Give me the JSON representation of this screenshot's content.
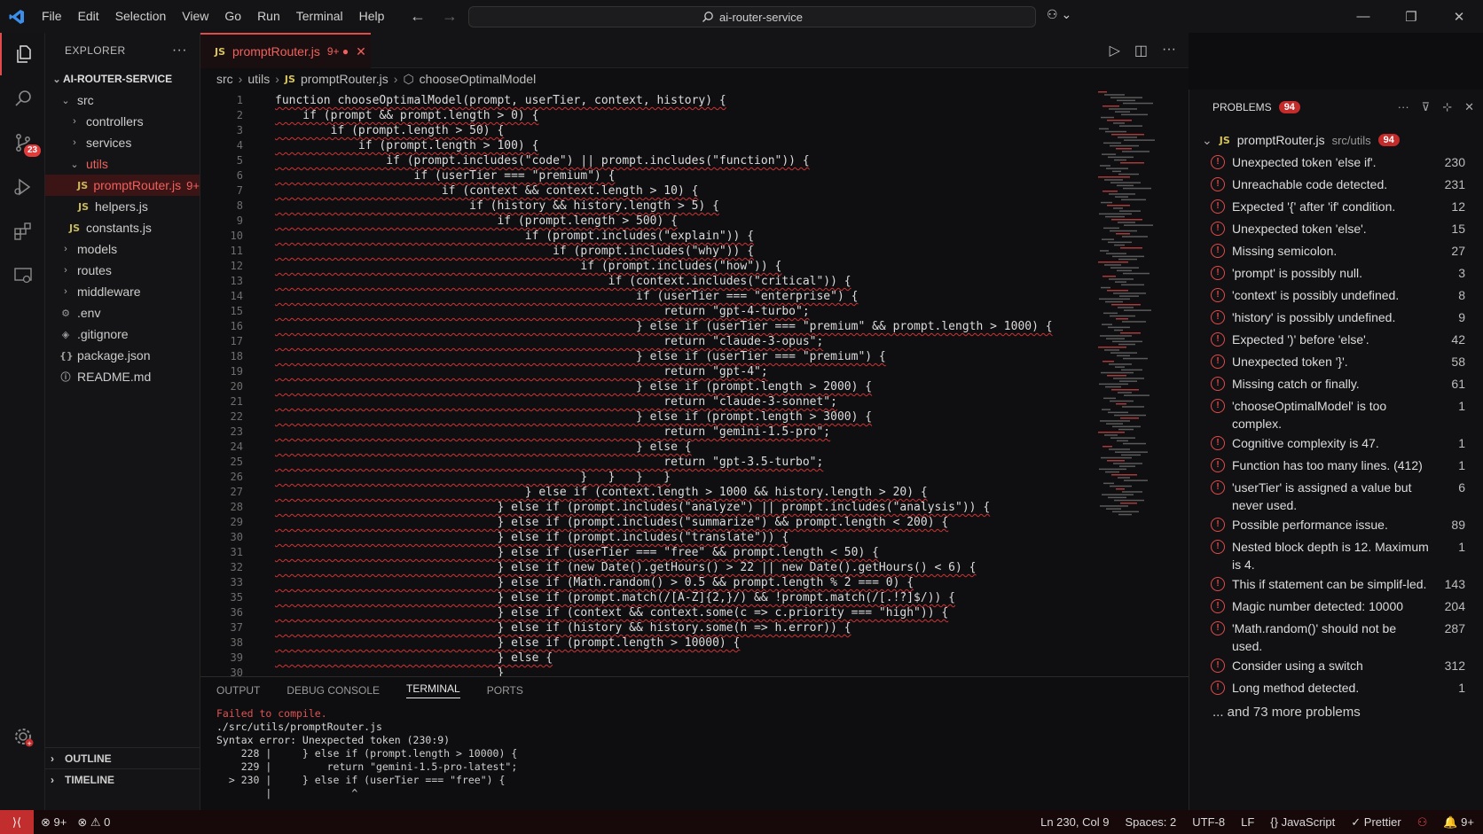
{
  "menu": [
    "File",
    "Edit",
    "Selection",
    "View",
    "Go",
    "Run",
    "Terminal",
    "Help"
  ],
  "command_center": "ai-router-service",
  "activity_badge": "23",
  "explorer": {
    "title": "EXPLORER",
    "root": "AI-ROUTER-SERVICE",
    "items": [
      {
        "label": "src",
        "kind": "folder-open",
        "indent": 1
      },
      {
        "label": "controllers",
        "kind": "folder",
        "indent": 2
      },
      {
        "label": "services",
        "kind": "folder",
        "indent": 2
      },
      {
        "label": "utils",
        "kind": "folder-open",
        "indent": 2,
        "red": true
      },
      {
        "label": "promptRouter.js",
        "kind": "js",
        "indent": 3,
        "red": true,
        "selected": true,
        "count": "9+"
      },
      {
        "label": "helpers.js",
        "kind": "js",
        "indent": 3
      },
      {
        "label": "constants.js",
        "kind": "js",
        "indent": 2
      },
      {
        "label": "models",
        "kind": "folder",
        "indent": 1
      },
      {
        "label": "routes",
        "kind": "folder",
        "indent": 1
      },
      {
        "label": "middleware",
        "kind": "folder",
        "indent": 1
      },
      {
        "label": ".env",
        "kind": "gear",
        "indent": 1
      },
      {
        "label": ".gitignore",
        "kind": "diamond",
        "indent": 1
      },
      {
        "label": "package.json",
        "kind": "braces",
        "indent": 1
      },
      {
        "label": "README.md",
        "kind": "info",
        "indent": 1
      }
    ],
    "outline": "OUTLINE",
    "timeline": "TIMELINE"
  },
  "tab": {
    "label": "promptRouter.js",
    "suffix": "9+ ●",
    "icon": "JS"
  },
  "breadcrumb": [
    "src",
    "utils",
    "promptRouter.js",
    "chooseOptimalModel"
  ],
  "code_lines": [
    {
      "n": "1",
      "t": "function chooseOptimalModel(prompt, userTier, context, history) {"
    },
    {
      "n": "2",
      "t": "    if (prompt && prompt.length > 0) {"
    },
    {
      "n": "3",
      "t": "        if (prompt.length > 50) {"
    },
    {
      "n": "4",
      "t": "            if (prompt.length > 100) {"
    },
    {
      "n": "5",
      "t": "                if (prompt.includes(\"code\") || prompt.includes(\"function\")) {"
    },
    {
      "n": "6",
      "t": "                    if (userTier === \"premium\") {"
    },
    {
      "n": "7",
      "t": "                        if (context && context.length > 10) {"
    },
    {
      "n": "8",
      "t": "                            if (history && history.length > 5) {"
    },
    {
      "n": "9",
      "t": "                                if (prompt.length > 500) {"
    },
    {
      "n": "10",
      "t": "                                    if (prompt.includes(\"explain\")) {"
    },
    {
      "n": "11",
      "t": "                                        if (prompt.includes(\"why\")) {"
    },
    {
      "n": "12",
      "t": "                                            if (prompt.includes(\"how\")) {"
    },
    {
      "n": "13",
      "t": "                                                if (context.includes(\"critical\")) {"
    },
    {
      "n": "14",
      "t": "                                                    if (userTier === \"enterprise\") {"
    },
    {
      "n": "15",
      "t": "                                                        return \"gpt-4-turbo\";"
    },
    {
      "n": "16",
      "t": "                                                    } else if (userTier === \"premium\" && prompt.length > 1000) {"
    },
    {
      "n": "17",
      "t": "                                                        return \"claude-3-opus\";"
    },
    {
      "n": "18",
      "t": "                                                    } else if (userTier === \"premium\") {"
    },
    {
      "n": "19",
      "t": "                                                        return \"gpt-4\";"
    },
    {
      "n": "20",
      "t": "                                                    } else if (prompt.length > 2000) {"
    },
    {
      "n": "21",
      "t": "                                                        return \"claude-3-sonnet\";"
    },
    {
      "n": "22",
      "t": "                                                    } else if (prompt.length > 3000) {"
    },
    {
      "n": "23",
      "t": "                                                        return \"gemini-1.5-pro\";"
    },
    {
      "n": "24",
      "t": "                                                    } else {"
    },
    {
      "n": "25",
      "t": "                                                        return \"gpt-3.5-turbo\";"
    },
    {
      "n": "26",
      "t": "                                            }   }   }   }"
    },
    {
      "n": "27",
      "t": "                                    } else if (context.length > 1000 && history.length > 20) {"
    },
    {
      "n": "28",
      "t": "                                } else if (prompt.includes(\"analyze\") || prompt.includes(\"analysis\")) {"
    },
    {
      "n": "29",
      "t": "                                } else if (prompt.includes(\"summarize\") && prompt.length < 200) {"
    },
    {
      "n": "30",
      "t": "                                } else if (prompt.includes(\"translate\")) {"
    },
    {
      "n": "31",
      "t": "                                } else if (userTier === \"free\" && prompt.length < 50) {"
    },
    {
      "n": "32",
      "t": "                                } else if (new Date().getHours() > 22 || new Date().getHours() < 6) {"
    },
    {
      "n": "33",
      "t": "                                } else if (Math.random() > 0.5 && prompt.length % 2 === 0) {"
    },
    {
      "n": "35",
      "t": "                                } else if (prompt.match(/[A-Z]{2,}/) && !prompt.match(/[.!?]$/)) {"
    },
    {
      "n": "36",
      "t": "                                } else if (context && context.some(c => c.priority === \"high\")) {"
    },
    {
      "n": "37",
      "t": "                                } else if (history && history.some(h => h.error)) {"
    },
    {
      "n": "38",
      "t": "                                } else if (prompt.length > 10000) {"
    },
    {
      "n": "39",
      "t": "                                } else {"
    },
    {
      "n": "30",
      "t": "                                }"
    }
  ],
  "panel": {
    "tabs": [
      "OUTPUT",
      "DEBUG CONSOLE",
      "TERMINAL",
      "PORTS"
    ],
    "active_tab": "TERMINAL",
    "terminal": [
      {
        "t": "Failed to compile.",
        "c": "#e05252"
      },
      {
        "t": "./src/utils/promptRouter.js",
        "c": "#d6d6d6"
      },
      {
        "t": "Syntax error: Unexpected token (230:9)",
        "c": "#d6d6d6"
      },
      {
        "t": "    228 |     } else if (prompt.length > 10000) {",
        "c": "#cfcfcf"
      },
      {
        "t": "    229 |         return \"gemini-1.5-pro-latest\";",
        "c": "#cfcfcf"
      },
      {
        "t": "  > 230 |     } else if (userTier === \"free\") {",
        "c": "#cfcfcf"
      },
      {
        "t": "        |             ^",
        "c": "#cfcfcf"
      }
    ]
  },
  "problems": {
    "title": "PROBLEMS",
    "count": "94",
    "file": "promptRouter.js",
    "path": "src/utils",
    "file_count": "94",
    "items": [
      {
        "msg": "Unexpected token 'else if'.",
        "line": "230"
      },
      {
        "msg": "Unreachable code detected.",
        "line": "231"
      },
      {
        "msg": "Expected '{' after 'if' condition.",
        "line": "12"
      },
      {
        "msg": "Unexpected token 'else'.",
        "line": "15"
      },
      {
        "msg": "Missing semicolon.",
        "line": "27"
      },
      {
        "msg": "'prompt' is possibly null.",
        "line": "3"
      },
      {
        "msg": "'context' is possibly undefined.",
        "line": "8"
      },
      {
        "msg": "'history' is possibly undefined.",
        "line": "9"
      },
      {
        "msg": "Expected ')' before 'else'.",
        "line": "42"
      },
      {
        "msg": "Unexpected token '}'.",
        "line": "58"
      },
      {
        "msg": "Missing catch or finally.",
        "line": "61"
      },
      {
        "msg": "'chooseOptimalModel' is too complex.",
        "line": "1"
      },
      {
        "msg": "Cognitive complexity is 47.",
        "line": "1"
      },
      {
        "msg": "Function has too many lines. (412)",
        "line": "1"
      },
      {
        "msg": "'userTier' is assigned a value but never used.",
        "line": "6"
      },
      {
        "msg": "Possible performance issue.",
        "line": "89"
      },
      {
        "msg": "Nested block depth is 12. Maximum is 4.",
        "line": "1"
      },
      {
        "msg": "This if statement can be simplif-led.",
        "line": "143"
      },
      {
        "msg": "Magic number detected: 10000",
        "line": "204"
      },
      {
        "msg": "'Math.random()' should not be used.",
        "line": "287"
      },
      {
        "msg": "Consider using a switch",
        "line": "312"
      },
      {
        "msg": "Long method detected.",
        "line": "1"
      }
    ],
    "more": "... and 73 more problems"
  },
  "status": {
    "errors": "9+",
    "warnings": "0",
    "position": "Ln 230, Col 9",
    "spaces": "Spaces: 2",
    "encoding": "UTF-8",
    "eol": "LF",
    "language": "JavaScript",
    "prettier": "Prettier",
    "right_badge": "9+"
  },
  "colors": {
    "accent": "#e24b4b",
    "error": "#e05252"
  }
}
